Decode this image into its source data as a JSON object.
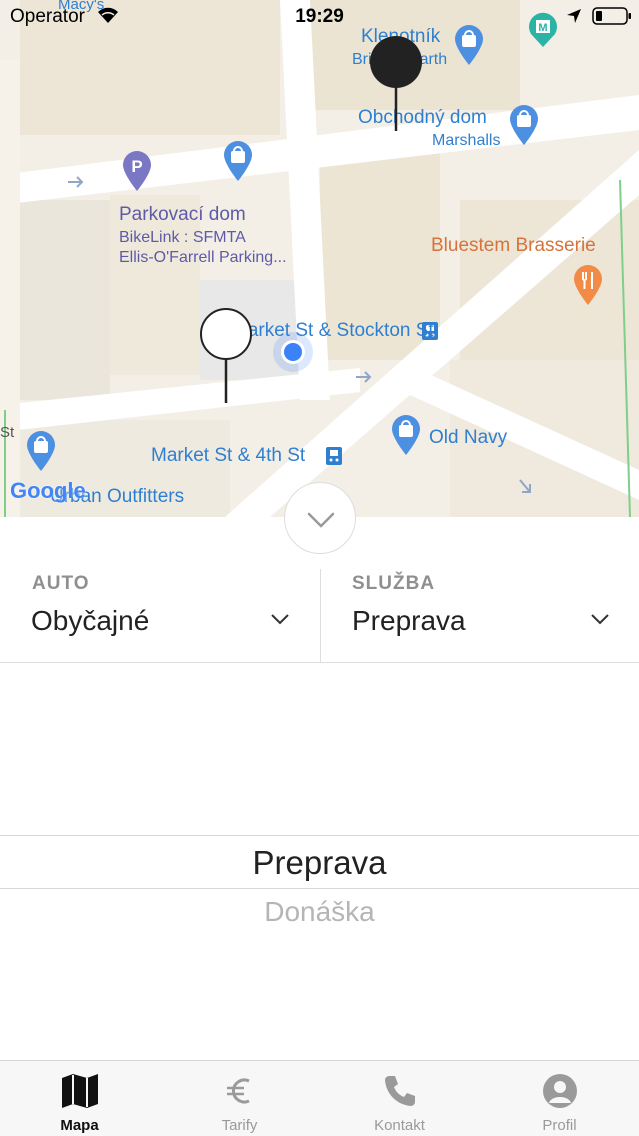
{
  "status_bar": {
    "carrier": "Operator",
    "time": "19:29"
  },
  "map": {
    "labels": {
      "macys": "Macy's",
      "klenotnik": "Klenotník",
      "brilliant_earth": "Brilliant Earth",
      "obchodny_dom": "Obchodný dom",
      "marshalls": "Marshalls",
      "parkovaci_dom": "Parkovací dom",
      "bikelink": "BikeLink : SFMTA",
      "ellis_ofarrell": "Ellis-O'Farrell Parking...",
      "bluestem": "Bluestem Brasserie",
      "market_stockton": "Market St & Stockton St",
      "market_4th": "Market St & 4th St",
      "old_navy": "Old Navy",
      "outfitters": "Urban Outfitters",
      "st_fragment": "St",
      "google": "Google"
    },
    "icons": [
      "shopping-bag-icon",
      "parking-icon",
      "restaurant-icon",
      "transit-icon",
      "metro-icon",
      "user-location-icon",
      "pickup-pin-icon",
      "dropoff-pin-icon"
    ]
  },
  "selectors": {
    "car": {
      "label": "AUTO",
      "value": "Obyčajné"
    },
    "service": {
      "label": "SLUŽBA",
      "value": "Preprava"
    }
  },
  "picker": {
    "selected": "Preprava",
    "next": "Donáška"
  },
  "tabbar": {
    "items": [
      {
        "label": "Mapa",
        "icon": "map-icon",
        "active": true
      },
      {
        "label": "Tarify",
        "icon": "euro-icon",
        "active": false
      },
      {
        "label": "Kontakt",
        "icon": "phone-icon",
        "active": false
      },
      {
        "label": "Profil",
        "icon": "profile-icon",
        "active": false
      }
    ]
  },
  "colors": {
    "map_bg": "#f3efe6",
    "road": "#ffffff",
    "poi_blue": "#2f7fd0",
    "poi_purple": "#5f5aa8",
    "poi_orange": "#d6733b",
    "user_location": "#3b82f6"
  }
}
